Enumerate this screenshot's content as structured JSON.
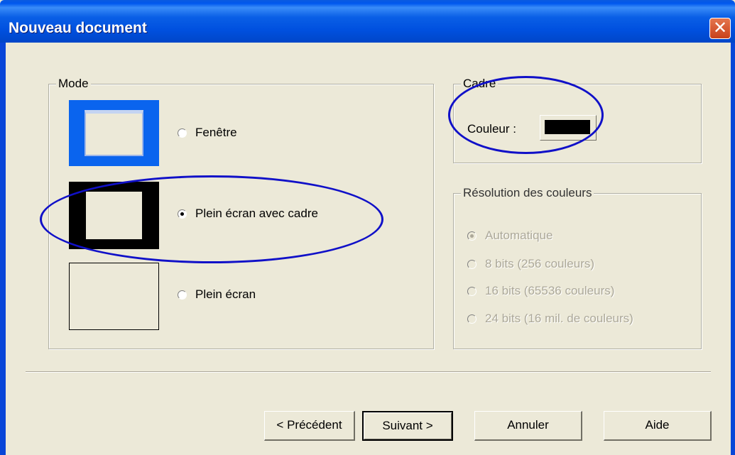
{
  "window": {
    "title": "Nouveau document",
    "close_glyph": "✕"
  },
  "mode_group": {
    "legend": "Mode",
    "options": [
      {
        "label": "Fenêtre",
        "selected": false
      },
      {
        "label": "Plein écran avec cadre",
        "selected": true
      },
      {
        "label": "Plein écran",
        "selected": false
      }
    ]
  },
  "cadre_group": {
    "legend": "Cadre",
    "color_label": "Couleur :",
    "color_value": "#000000"
  },
  "resolution_group": {
    "legend": "Résolution des couleurs",
    "options": [
      {
        "label": "Automatique",
        "selected": true
      },
      {
        "label": "8 bits (256 couleurs)",
        "selected": false
      },
      {
        "label": "16 bits (65536 couleurs)",
        "selected": false
      },
      {
        "label": "24 bits (16 mil. de couleurs)",
        "selected": false
      }
    ]
  },
  "buttons": {
    "previous": "< Précédent",
    "next": "Suivant >",
    "cancel": "Annuler",
    "help": "Aide"
  },
  "annotation_color": "#1010C8"
}
